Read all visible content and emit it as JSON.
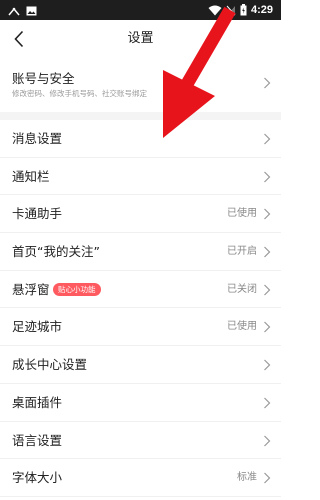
{
  "status_bar": {
    "time": "4:29",
    "icons": [
      "signal-icon",
      "image-icon",
      "wifi-icon",
      "no-sim-icon",
      "battery-icon"
    ]
  },
  "header": {
    "title": "设置",
    "back_icon": "chevron-left-icon"
  },
  "account": {
    "title": "账号与安全",
    "description": "修改密码、修改手机号码、社交账号绑定"
  },
  "items": [
    {
      "label": "消息设置",
      "value": ""
    },
    {
      "label": "通知栏",
      "value": ""
    },
    {
      "label": "卡通助手",
      "value": "已使用"
    },
    {
      "label": "首页“我的关注”",
      "value": "已开启"
    },
    {
      "label": "悬浮窗",
      "value": "已关闭",
      "badge": "贴心小功能"
    },
    {
      "label": "足迹城市",
      "value": "已使用"
    },
    {
      "label": "成长中心设置",
      "value": ""
    },
    {
      "label": "桌面插件",
      "value": ""
    },
    {
      "label": "语言设置",
      "value": ""
    },
    {
      "label": "字体大小",
      "value": "标准"
    }
  ],
  "colors": {
    "badge": "#ff5a5f",
    "arrow": "#e8141c"
  }
}
